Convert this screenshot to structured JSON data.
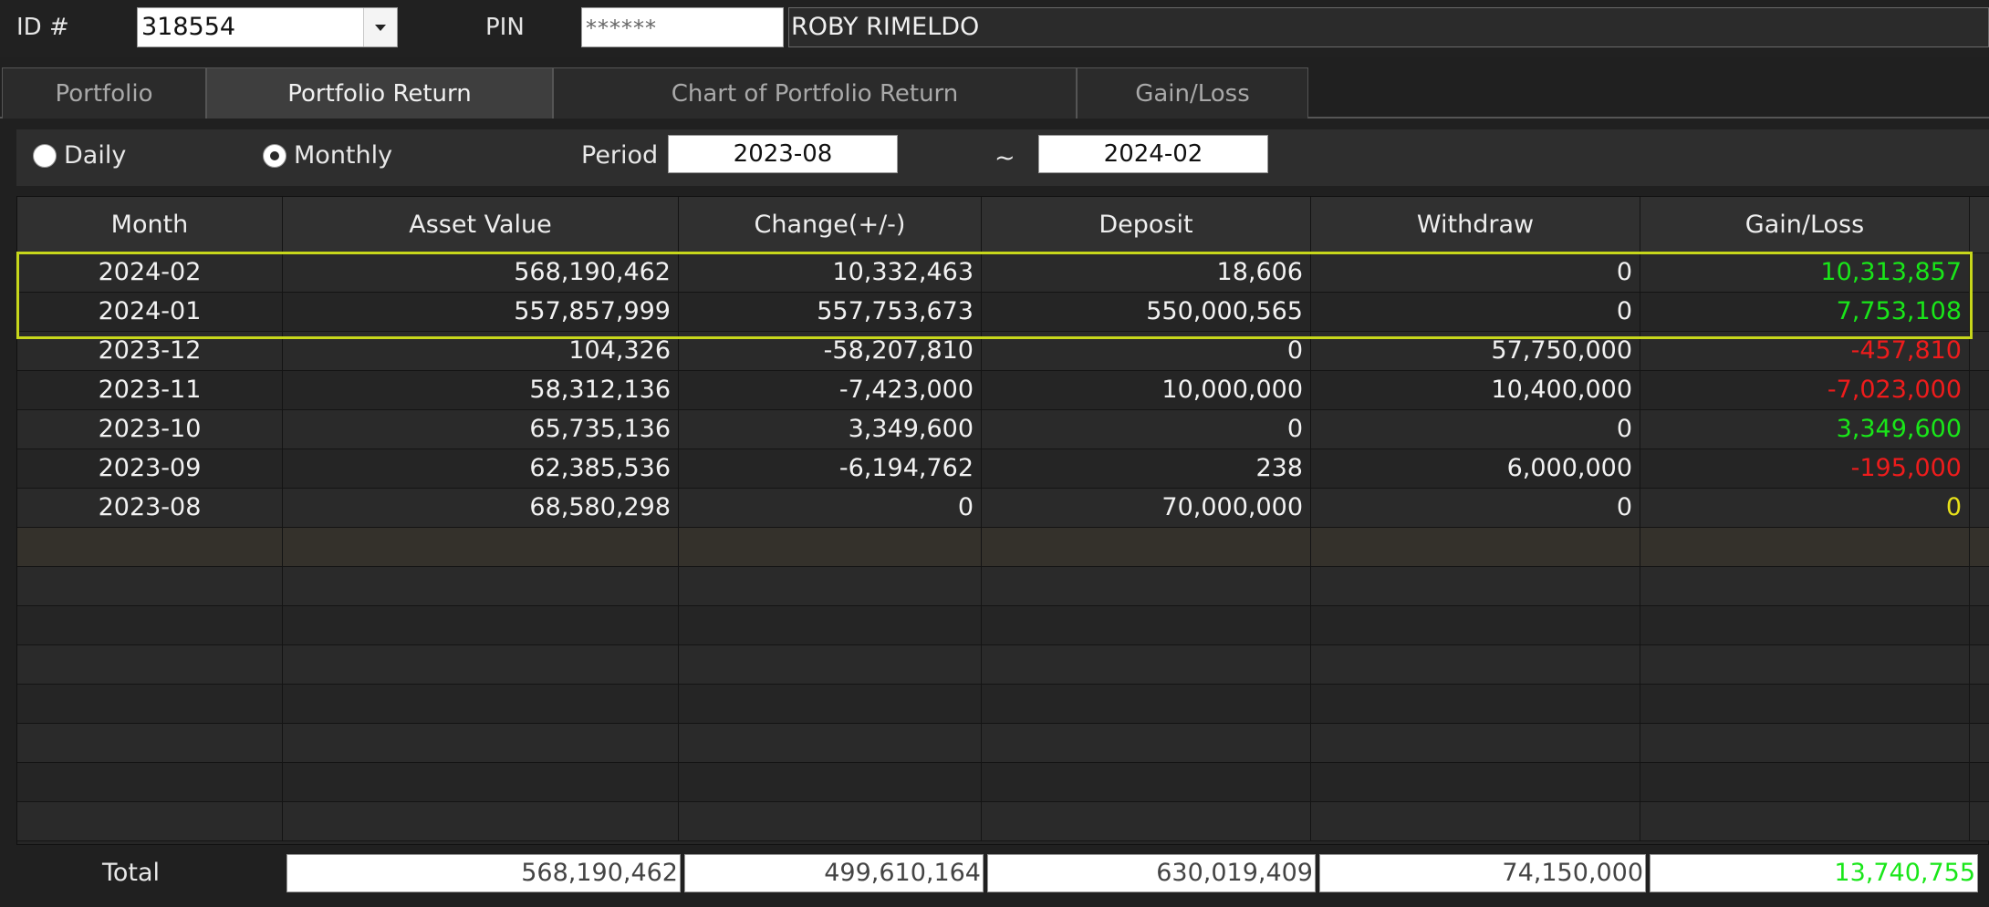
{
  "header": {
    "id_label": "ID #",
    "id_value": "318554",
    "pin_label": "PIN",
    "pin_value": "******",
    "account_name": "ROBY RIMELDO"
  },
  "tabs": [
    {
      "label": "Portfolio",
      "active": false
    },
    {
      "label": "Portfolio Return",
      "active": true
    },
    {
      "label": "Chart of Portfolio Return",
      "active": false
    },
    {
      "label": "Gain/Loss",
      "active": false
    }
  ],
  "filter": {
    "daily_label": "Daily",
    "monthly_label": "Monthly",
    "selected": "Monthly",
    "period_label": "Period",
    "period_from": "2023-08",
    "separator": "~",
    "period_to": "2024-02"
  },
  "table": {
    "columns": [
      "Month",
      "Asset Value",
      "Change(+/-)",
      "Deposit",
      "Withdraw",
      "Gain/Loss"
    ],
    "rows": [
      {
        "month": "2024-02",
        "asset": "568,190,462",
        "change": "10,332,463",
        "deposit": "18,606",
        "withdraw": "0",
        "gain": "10,313,857",
        "gain_sign": "pos"
      },
      {
        "month": "2024-01",
        "asset": "557,857,999",
        "change": "557,753,673",
        "deposit": "550,000,565",
        "withdraw": "0",
        "gain": "7,753,108",
        "gain_sign": "pos"
      },
      {
        "month": "2023-12",
        "asset": "104,326",
        "change": "-58,207,810",
        "deposit": "0",
        "withdraw": "57,750,000",
        "gain": "-457,810",
        "gain_sign": "neg"
      },
      {
        "month": "2023-11",
        "asset": "58,312,136",
        "change": "-7,423,000",
        "deposit": "10,000,000",
        "withdraw": "10,400,000",
        "gain": "-7,023,000",
        "gain_sign": "neg"
      },
      {
        "month": "2023-10",
        "asset": "65,735,136",
        "change": "3,349,600",
        "deposit": "0",
        "withdraw": "0",
        "gain": "3,349,600",
        "gain_sign": "pos"
      },
      {
        "month": "2023-09",
        "asset": "62,385,536",
        "change": "-6,194,762",
        "deposit": "238",
        "withdraw": "6,000,000",
        "gain": "-195,000",
        "gain_sign": "neg"
      },
      {
        "month": "2023-08",
        "asset": "68,580,298",
        "change": "0",
        "deposit": "70,000,000",
        "withdraw": "0",
        "gain": "0",
        "gain_sign": "zero"
      }
    ],
    "highlighted_months": [
      "2024-02",
      "2024-01"
    ]
  },
  "total": {
    "label": "Total",
    "asset": "568,190,462",
    "change": "499,610,164",
    "deposit": "630,019,409",
    "withdraw": "74,150,000",
    "gain": "13,740,755"
  },
  "colors": {
    "positive": "#19e619",
    "negative": "#ee1c1c",
    "zero": "#e8e11a",
    "highlight_border": "#c7d71b"
  }
}
